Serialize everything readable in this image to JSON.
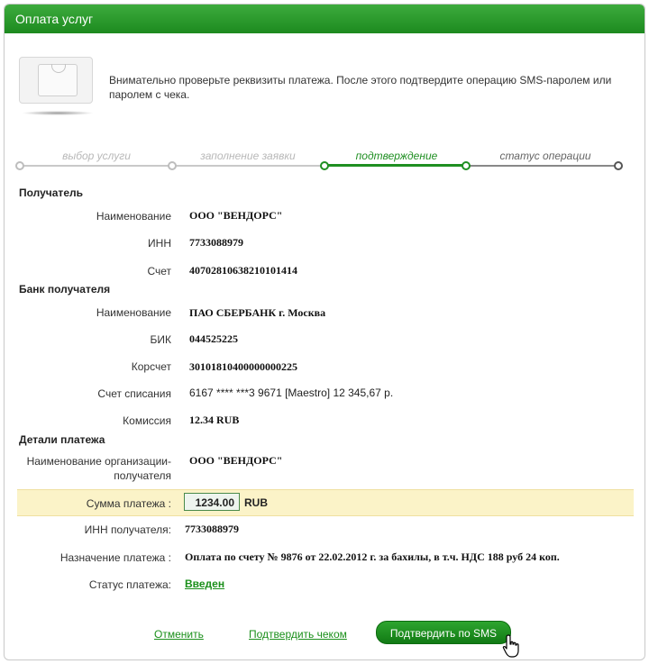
{
  "window": {
    "title": "Оплата услуг"
  },
  "intro": "Внимательно проверьте реквизиты платежа. После этого подтвердите операцию SMS-паролем или паролем с чека.",
  "steps": [
    {
      "label": "выбор услуги",
      "state": "done"
    },
    {
      "label": "заполнение заявки",
      "state": "done"
    },
    {
      "label": "подтверждение",
      "state": "active"
    },
    {
      "label": "статус операции",
      "state": "pending"
    }
  ],
  "recipient": {
    "title": "Получатель",
    "name_label": "Наименование",
    "name": "ООО \"ВЕНДОРС\"",
    "inn_label": "ИНН",
    "inn": "7733088979",
    "account_label": "Счет",
    "account": "40702810638210101414"
  },
  "bank": {
    "title": "Банк получателя",
    "name_label": "Наименование",
    "name": "ПАО СБЕРБАНК г. Москва",
    "bik_label": "БИК",
    "bik": "044525225",
    "corr_label": "Корсчет",
    "corr": "30101810400000000225",
    "debit_label": "Счет списания",
    "debit": "6167 **** ***3 9671  [Maestro] 12 345,67  р.",
    "fee_label": "Комиссия",
    "fee": "12.34 RUB"
  },
  "details": {
    "title": "Детали платежа",
    "org_label_1": "Наименование организации-",
    "org_label_2": "получателя",
    "org": "ООО \"ВЕНДОРС\"",
    "amount_label": "Сумма платежа :",
    "amount": "1234.00",
    "currency": "RUB",
    "inn_label": "ИНН получателя:",
    "inn": "7733088979",
    "purpose_label": "Назначение платежа :",
    "purpose": "Оплата по счету № 9876 от 22.02.2012 г. за бахилы, в т.ч. НДС 188 руб 24 коп.",
    "status_label": "Статус платежа:",
    "status": "Введен"
  },
  "actions": {
    "cancel": "Отменить",
    "confirm_check": "Подтвердить чеком",
    "confirm_sms": "Подтвердить по SMS"
  },
  "colors": {
    "accent": "#1f8f22",
    "highlight": "#fbf3c8"
  }
}
